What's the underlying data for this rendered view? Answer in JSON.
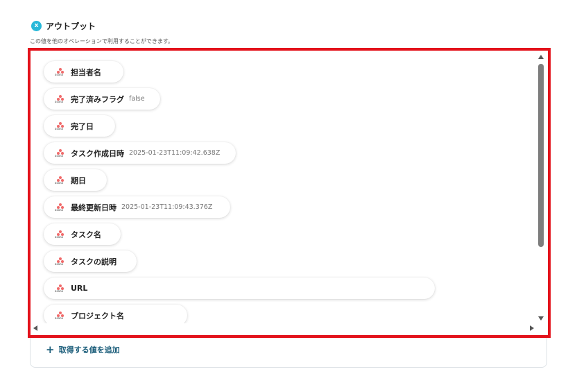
{
  "header": {
    "icon_letter": "x",
    "title": "アウトプット",
    "subtitle": "この値を他のオペレーションで利用することができます。"
  },
  "app_logo_text": "asana",
  "outputs": [
    {
      "label": "担当者名",
      "value": ""
    },
    {
      "label": "完了済みフラグ",
      "value": "false"
    },
    {
      "label": "完了日",
      "value": ""
    },
    {
      "label": "タスク作成日時",
      "value": "2025-01-23T11:09:42.638Z"
    },
    {
      "label": "期日",
      "value": ""
    },
    {
      "label": "最終更新日時",
      "value": "2025-01-23T11:09:43.376Z"
    },
    {
      "label": "タスク名",
      "value": ""
    },
    {
      "label": "タスクの説明",
      "value": ""
    },
    {
      "label": "URL",
      "value": ""
    },
    {
      "label": "プロジェクト名",
      "value": ""
    }
  ],
  "add_button": {
    "icon": "+",
    "label": "取得する値を追加"
  },
  "colors": {
    "highlight": "#e3121b",
    "accent": "#1b5d7a",
    "header_icon": "#27b8d9",
    "asana": "#f06a6a"
  }
}
